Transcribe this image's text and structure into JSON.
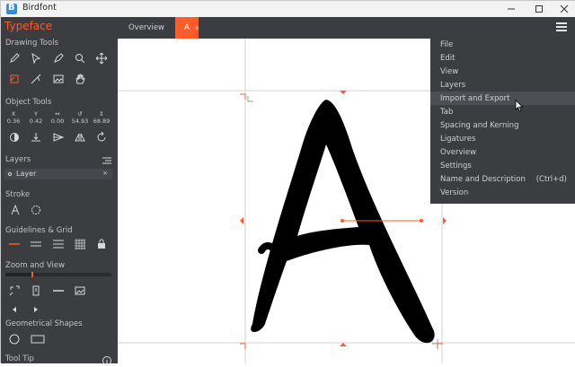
{
  "window": {
    "title": "Birdfont"
  },
  "sidebar": {
    "brand": "Typeface",
    "sections": {
      "drawing_tools": "Drawing Tools",
      "object_tools": "Object Tools",
      "layers": "Layers",
      "stroke": "Stroke",
      "guidelines": "Guidelines & Grid",
      "zoom": "Zoom and View",
      "shapes": "Geometrical Shapes",
      "tooltip": "Tool Tip"
    },
    "metrics": [
      {
        "key": "X",
        "value": "0.36"
      },
      {
        "key": "Y",
        "value": "0.42"
      },
      {
        "key": "↔",
        "value": "0.00"
      },
      {
        "key": "↺",
        "value": "54.93"
      },
      {
        "key": "↕",
        "value": "68.89"
      }
    ],
    "layer": {
      "label": "Layer"
    }
  },
  "tabs": [
    {
      "label": "Overview"
    },
    {
      "label": "A",
      "close": "×"
    }
  ],
  "menu": {
    "items": [
      {
        "label": "File"
      },
      {
        "label": "Edit"
      },
      {
        "label": "View"
      },
      {
        "label": "Layers"
      },
      {
        "label": "Import and Export"
      },
      {
        "label": "Tab"
      },
      {
        "label": "Spacing and Kerning"
      },
      {
        "label": "Ligatures"
      },
      {
        "label": "Overview"
      },
      {
        "label": "Settings"
      },
      {
        "label": "Name and Description",
        "shortcut": "(Ctrl+d)"
      },
      {
        "label": "Version"
      }
    ],
    "hovered_index": 4
  },
  "colors": {
    "accent": "#ff5a2a",
    "panel": "#3b3d41"
  },
  "icons": [
    "pen-icon",
    "pointer-icon",
    "bezier-icon",
    "zoom-icon",
    "move-icon",
    "hand-icon"
  ]
}
